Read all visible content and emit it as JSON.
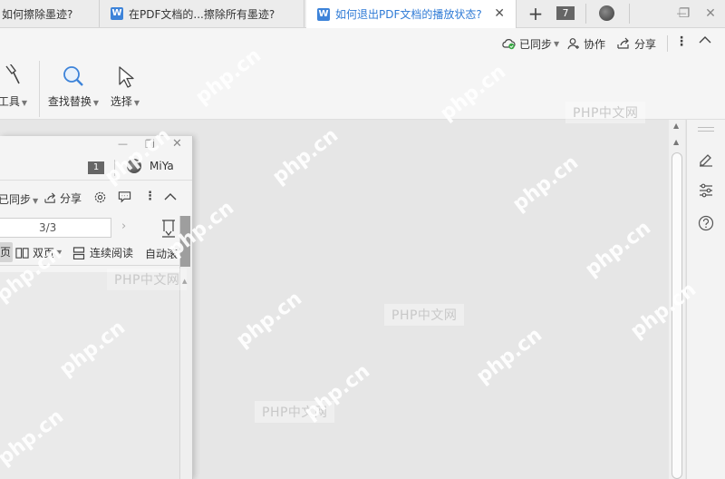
{
  "tabs": [
    {
      "label": "如何擦除墨迹?",
      "active": false
    },
    {
      "label": "在PDF文档的...擦除所有墨迹?",
      "active": false
    },
    {
      "label": "如何退出PDF文档的播放状态?",
      "active": true
    }
  ],
  "tabbar": {
    "new_tab": "+",
    "tab_count": "7",
    "minimize": "—",
    "restore": "❐",
    "close": "✕",
    "tab_close": "✕",
    "wps_letter": "W"
  },
  "top_actions": {
    "synced": "已同步",
    "collaborate": "协作",
    "share": "分享",
    "more": "⋮",
    "collapse": "^"
  },
  "ribbon": {
    "tools": "工具",
    "find_replace": "查找替换",
    "select": "选择"
  },
  "inner_window": {
    "tab_count": "1",
    "user_name": "MiYa",
    "synced": "已同步",
    "share": "分享",
    "page_indicator": "3/3",
    "view_single_partial": "页",
    "view_double": "双页",
    "view_continuous": "连续阅读",
    "auto_scroll_partial": "自动滚"
  },
  "watermarks": {
    "box_text": "PHP中文网",
    "diagonal_text": "php.cn"
  },
  "colors": {
    "accent": "#2f7bd6",
    "float_button": "#3d83d9"
  }
}
